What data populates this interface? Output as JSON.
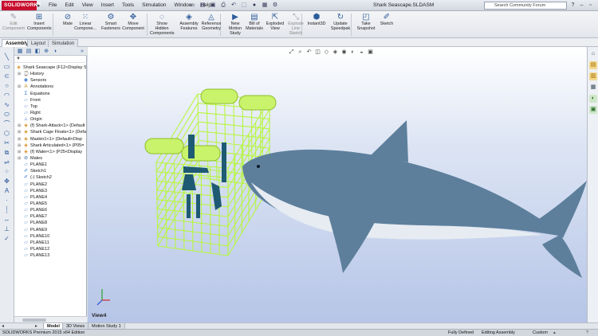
{
  "titlebar": {
    "app_logo": "SOLIDWORKS",
    "menu": [
      "File",
      "Edit",
      "View",
      "Insert",
      "Tools",
      "Simulation",
      "Window",
      "Help"
    ],
    "document_title": "Shark Seascape.SLDASM",
    "search_placeholder": "Search Community Forum"
  },
  "ribbon": {
    "buttons": [
      {
        "id": "edit-component",
        "label": "Edit\nComponent",
        "icon": "edit-component-icon",
        "disabled": true
      },
      {
        "id": "insert-components",
        "label": "Insert\nComponents",
        "icon": "insert-components-icon",
        "disabled": false
      },
      {
        "id": "mate",
        "label": "Mate",
        "icon": "mate-icon",
        "disabled": false
      },
      {
        "id": "linear-component",
        "label": "Linear\nCompone...",
        "icon": "linear-pattern-icon",
        "disabled": false
      },
      {
        "id": "smart-fasteners",
        "label": "Smart\nFasteners",
        "icon": "smart-fasteners-icon",
        "disabled": false
      },
      {
        "id": "move-component",
        "label": "Move\nComponent",
        "icon": "move-component-icon",
        "disabled": false
      },
      {
        "id": "show-hidden-components",
        "label": "Show\nHidden\nComponents",
        "icon": "show-hidden-icon",
        "disabled": false
      },
      {
        "id": "assembly-features",
        "label": "Assembly\nFeatures",
        "icon": "assembly-features-icon",
        "disabled": false
      },
      {
        "id": "reference-geometry",
        "label": "Reference\nGeometry",
        "icon": "reference-geometry-icon",
        "disabled": false
      },
      {
        "id": "new-motion-study",
        "label": "New\nMotion\nStudy",
        "icon": "motion-study-icon",
        "disabled": false
      },
      {
        "id": "bill-of-materials",
        "label": "Bill of\nMaterials",
        "icon": "bom-icon",
        "disabled": false
      },
      {
        "id": "exploded-view",
        "label": "Exploded\nView",
        "icon": "exploded-view-icon",
        "disabled": false
      },
      {
        "id": "explode-line-sketch",
        "label": "Explode\nLine\nSketch",
        "icon": "explode-line-icon",
        "disabled": true
      },
      {
        "id": "instant3d",
        "label": "Instant3D",
        "icon": "instant3d-icon",
        "disabled": false
      },
      {
        "id": "update-speedpak",
        "label": "Update\nSpeedpak",
        "icon": "speedpak-icon",
        "disabled": false
      },
      {
        "id": "take-snapshot",
        "label": "Take\nSnapshot",
        "icon": "snapshot-icon",
        "disabled": false
      },
      {
        "id": "sketch",
        "label": "Sketch",
        "icon": "sketch-icon",
        "disabled": false
      }
    ]
  },
  "command_tabs": [
    "Assembly",
    "Layout",
    "Simulation"
  ],
  "feature_tree": {
    "root": "Shark Seascape (F12<Display S",
    "items": [
      {
        "label": "History",
        "icon": "history-icon",
        "expand": true
      },
      {
        "label": "Sensors",
        "icon": "sensors-icon",
        "expand": false
      },
      {
        "label": "Annotations",
        "icon": "annotations-icon",
        "expand": true
      },
      {
        "label": "Equations",
        "icon": "equations-icon",
        "expand": false
      },
      {
        "label": "Front",
        "icon": "plane-icon",
        "expand": false
      },
      {
        "label": "Top",
        "icon": "plane-icon",
        "expand": false
      },
      {
        "label": "Right",
        "icon": "plane-icon",
        "expand": false
      },
      {
        "label": "Origin",
        "icon": "origin-icon",
        "expand": false
      },
      {
        "label": "(f) Shark-Attack<1> (Default",
        "icon": "part-icon",
        "expand": true
      },
      {
        "label": "Shark Cage Floats<1> (Defa",
        "icon": "part-icon",
        "expand": true
      },
      {
        "label": "Maskin1<1> (Default<Disp",
        "icon": "part-icon",
        "expand": true
      },
      {
        "label": "Shark Articulated<1> (P05=",
        "icon": "part-icon",
        "expand": true
      },
      {
        "label": "(f) Water<1> (P25<Display",
        "icon": "part-icon",
        "expand": true
      },
      {
        "label": "Mates",
        "icon": "mates-icon",
        "expand": true
      },
      {
        "label": "PLANE1",
        "icon": "plane-icon",
        "expand": false
      },
      {
        "label": "Sketch1",
        "icon": "sketch-tree-icon",
        "expand": false
      },
      {
        "label": "(-) Sketch2",
        "icon": "sketch-tree-icon",
        "expand": false
      },
      {
        "label": "PLANE2",
        "icon": "plane-icon",
        "expand": false
      },
      {
        "label": "PLANE3",
        "icon": "plane-icon",
        "expand": false
      },
      {
        "label": "PLANE4",
        "icon": "plane-icon",
        "expand": false
      },
      {
        "label": "PLANE5",
        "icon": "plane-icon",
        "expand": false
      },
      {
        "label": "PLANE6",
        "icon": "plane-icon",
        "expand": false
      },
      {
        "label": "PLANE7",
        "icon": "plane-icon",
        "expand": false
      },
      {
        "label": "PLANE8",
        "icon": "plane-icon",
        "expand": false
      },
      {
        "label": "PLANE9",
        "icon": "plane-icon",
        "expand": false
      },
      {
        "label": "PLANE10",
        "icon": "plane-icon",
        "expand": false
      },
      {
        "label": "PLANE11",
        "icon": "plane-icon",
        "expand": false
      },
      {
        "label": "PLANE12",
        "icon": "plane-icon",
        "expand": false
      },
      {
        "label": "PLANE13",
        "icon": "plane-icon",
        "expand": false
      }
    ]
  },
  "viewport": {
    "view_label": "View4",
    "cage_color": "#b8f542",
    "float_color": "#c9f36a",
    "shark_body_color": "#5d7f9c",
    "shark_belly_color": "#e6ecf2",
    "diver_color": "#1f5a73"
  },
  "bottom_tabs": [
    "Model",
    "3D Views",
    "Motion Study 1"
  ],
  "status": {
    "edition": "SOLIDWORKS Premium 2015 x64 Edition",
    "fully_defined": "Fully Defined",
    "mode": "Editing Assembly",
    "units": "Custom"
  }
}
